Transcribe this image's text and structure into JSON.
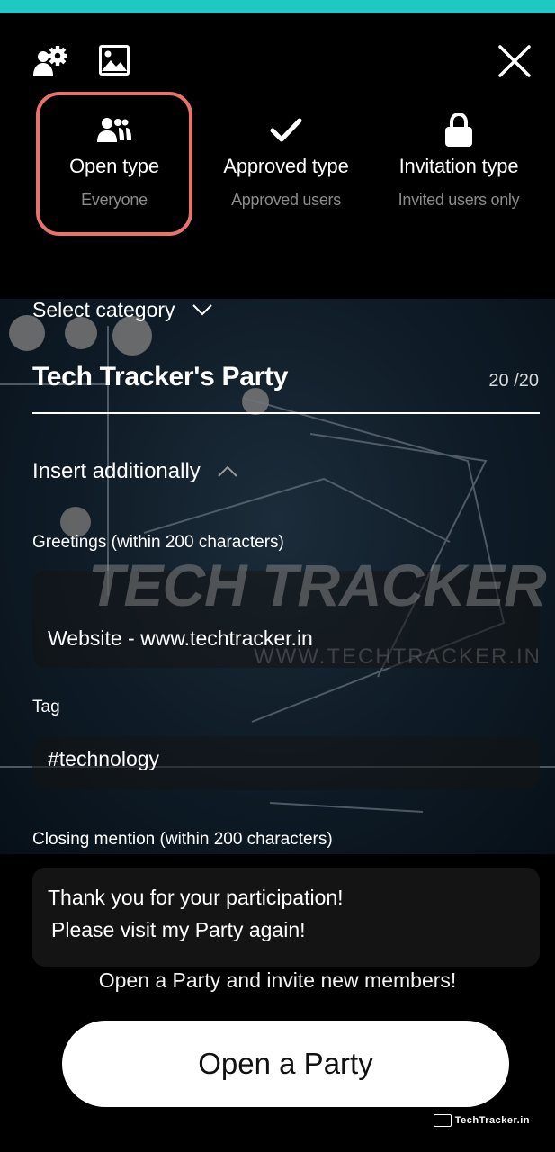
{
  "header": {
    "icons": [
      "settings-users-icon",
      "image-icon",
      "close-icon"
    ]
  },
  "party_types": [
    {
      "label": "Open type",
      "sub": "Everyone",
      "icon": "group-icon",
      "selected": true
    },
    {
      "label": "Approved type",
      "sub": "Approved users",
      "icon": "check-icon",
      "selected": false
    },
    {
      "label": "Invitation type",
      "sub": "Invited users only",
      "icon": "lock-icon",
      "selected": false
    }
  ],
  "form": {
    "select_category": "Select category",
    "party_title": "Tech Tracker's Party",
    "title_count": "20 /20",
    "insert_additionally": "Insert additionally",
    "greetings_label": "Greetings (within 200 characters)",
    "greetings_value": "Website - www.techtracker.in",
    "tag_label": "Tag",
    "tag_value": "#technology",
    "closing_label": "Closing mention (within 200 characters)",
    "closing_line1": "Thank you for your participation!",
    "closing_line2": "Please visit my Party again!"
  },
  "watermark": {
    "main": "TECH TRACKER",
    "sub": "WWW.TECHTRACKER.IN"
  },
  "footer": {
    "invite_text": "Open a Party and invite new members!",
    "open_button": "Open a Party",
    "corner_logo": "TechTracker.in"
  },
  "colors": {
    "accent_topbar": "#1ec9c3",
    "selected_border": "#e8736d"
  }
}
